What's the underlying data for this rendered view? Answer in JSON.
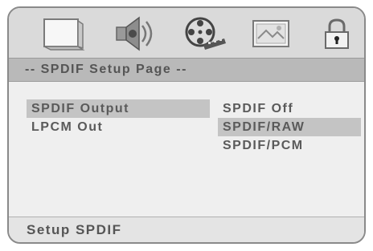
{
  "icon_bar": {
    "icons": [
      "monitor-icon",
      "speaker-icon",
      "film-reel-icon",
      "picture-icon",
      "lock-icon"
    ]
  },
  "header": {
    "title": "-- SPDIF Setup Page --"
  },
  "menu": {
    "items": [
      {
        "label": "SPDIF Output",
        "selected": true
      },
      {
        "label": "LPCM  Out",
        "selected": false
      }
    ]
  },
  "options": {
    "items": [
      {
        "label": "SPDIF Off",
        "selected": false
      },
      {
        "label": "SPDIF/RAW",
        "selected": true
      },
      {
        "label": "SPDIF/PCM",
        "selected": false
      }
    ]
  },
  "footer": {
    "status": "Setup  SPDIF"
  },
  "colors": {
    "panel_bg": "#eeeeee",
    "header_bg": "#b9b9b9",
    "selection_bg": "#c4c4c4",
    "text": "#5a5a5a"
  }
}
